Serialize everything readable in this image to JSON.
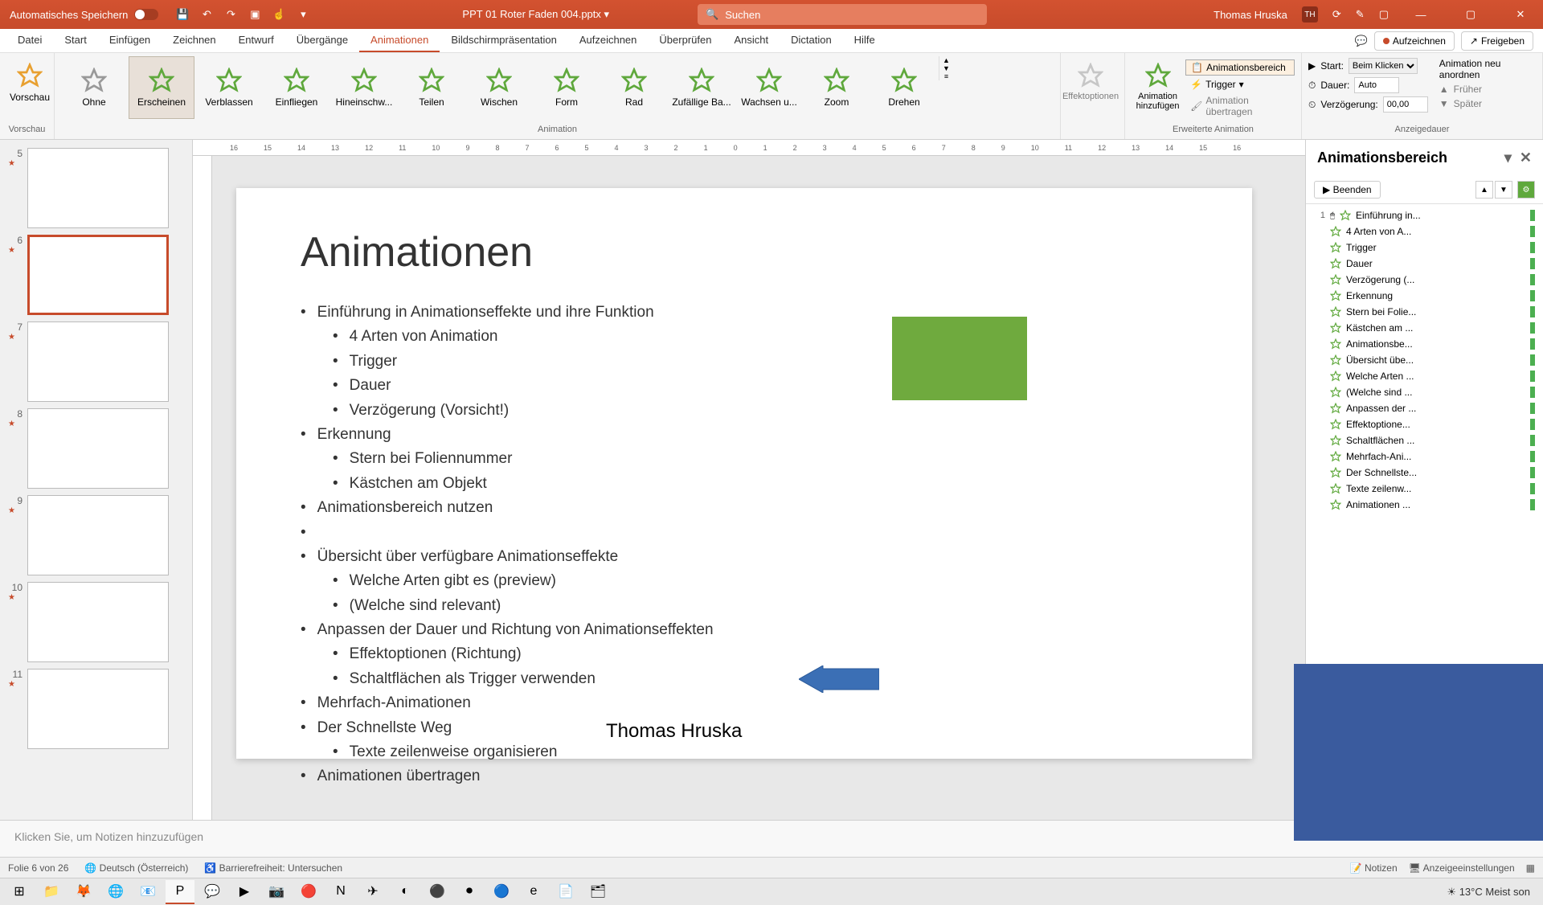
{
  "titlebar": {
    "autosave": "Automatisches Speichern",
    "filename": "PPT 01 Roter Faden 004.pptx",
    "search_placeholder": "Suchen",
    "username": "Thomas Hruska",
    "user_initials": "TH"
  },
  "tabs": {
    "items": [
      "Datei",
      "Start",
      "Einfügen",
      "Zeichnen",
      "Entwurf",
      "Übergänge",
      "Animationen",
      "Bildschirmpräsentation",
      "Aufzeichnen",
      "Überprüfen",
      "Ansicht",
      "Dictation",
      "Hilfe"
    ],
    "active_index": 6,
    "aufzeichnen": "Aufzeichnen",
    "freigeben": "Freigeben"
  },
  "ribbon": {
    "vorschau": "Vorschau",
    "vorschau_label": "Vorschau",
    "anims": [
      "Ohne",
      "Erscheinen",
      "Verblassen",
      "Einfliegen",
      "Hineinschw...",
      "Teilen",
      "Wischen",
      "Form",
      "Rad",
      "Zufällige Ba...",
      "Wachsen u...",
      "Zoom",
      "Drehen"
    ],
    "anim_group": "Animation",
    "effektoptionen": "Effektoptionen",
    "anim_hinzu": "Animation hinzufügen",
    "animbereich": "Animationsbereich",
    "trigger": "Trigger",
    "anim_uebertragen": "Animation übertragen",
    "erweiterte": "Erweiterte Animation",
    "start_label": "Start:",
    "start_val": "Beim Klicken",
    "dauer_label": "Dauer:",
    "dauer_val": "Auto",
    "verz_label": "Verzögerung:",
    "verz_val": "00,00",
    "neuanordnen": "Animation neu anordnen",
    "frueher": "Früher",
    "spaeter": "Später",
    "anzeigedauer": "Anzeigedauer"
  },
  "ruler": [
    "16",
    "15",
    "14",
    "13",
    "12",
    "11",
    "10",
    "9",
    "8",
    "7",
    "6",
    "5",
    "4",
    "3",
    "2",
    "1",
    "0",
    "1",
    "2",
    "3",
    "4",
    "5",
    "6",
    "7",
    "8",
    "9",
    "10",
    "11",
    "12",
    "13",
    "14",
    "15",
    "16"
  ],
  "thumbs": [
    {
      "num": "5"
    },
    {
      "num": "6",
      "active": true
    },
    {
      "num": "7"
    },
    {
      "num": "8"
    },
    {
      "num": "9"
    },
    {
      "num": "10"
    },
    {
      "num": "11"
    }
  ],
  "slide": {
    "title": "Animationen",
    "bullets": [
      {
        "t": "Einführung in Animationseffekte und ihre Funktion",
        "sub": [
          "4 Arten von Animation",
          "Trigger",
          "Dauer",
          "Verzögerung (Vorsicht!)"
        ]
      },
      {
        "t": "Erkennung",
        "sub": [
          "Stern bei Foliennummer",
          "Kästchen am Objekt"
        ]
      },
      {
        "t": "Animationsbereich nutzen",
        "sub": []
      },
      {
        "t": "",
        "sub": []
      },
      {
        "t": "Übersicht über verfügbare Animationseffekte",
        "sub": [
          "Welche Arten gibt es (preview)",
          "(Welche sind relevant)"
        ]
      },
      {
        "t": "Anpassen der Dauer und Richtung von Animationseffekten",
        "sub": [
          "Effektoptionen (Richtung)",
          "Schaltflächen als Trigger verwenden"
        ]
      },
      {
        "t": "Mehrfach-Animationen",
        "sub": []
      },
      {
        "t": "Der Schnellste Weg",
        "sub": [
          "Texte zeilenweise organisieren"
        ]
      },
      {
        "t": "Animationen übertragen",
        "sub": []
      }
    ],
    "author": "Thomas Hruska"
  },
  "pane": {
    "title": "Animationsbereich",
    "play": "Beenden",
    "items": [
      {
        "n": "1",
        "t": "Einführung in..."
      },
      {
        "n": "",
        "t": "4 Arten von A..."
      },
      {
        "n": "",
        "t": "Trigger"
      },
      {
        "n": "",
        "t": "Dauer"
      },
      {
        "n": "",
        "t": "Verzögerung (..."
      },
      {
        "n": "",
        "t": "Erkennung"
      },
      {
        "n": "",
        "t": "Stern bei Folie..."
      },
      {
        "n": "",
        "t": "Kästchen am ..."
      },
      {
        "n": "",
        "t": "Animationsbe..."
      },
      {
        "n": "",
        "t": "Übersicht übe..."
      },
      {
        "n": "",
        "t": "Welche Arten ..."
      },
      {
        "n": "",
        "t": "(Welche sind ..."
      },
      {
        "n": "",
        "t": "Anpassen der ..."
      },
      {
        "n": "",
        "t": "Effektoptione..."
      },
      {
        "n": "",
        "t": "Schaltflächen ..."
      },
      {
        "n": "",
        "t": "Mehrfach-Ani..."
      },
      {
        "n": "",
        "t": "Der Schnellste..."
      },
      {
        "n": "",
        "t": "Texte zeilenw..."
      },
      {
        "n": "",
        "t": "Animationen ..."
      }
    ]
  },
  "notes": "Klicken Sie, um Notizen hinzuzufügen",
  "status": {
    "slide": "Folie 6 von 26",
    "lang": "Deutsch (Österreich)",
    "access": "Barrierefreiheit: Untersuchen",
    "notizen": "Notizen",
    "anzeige": "Anzeigeeinstellungen"
  },
  "taskbar": {
    "weather": "13°C  Meist son"
  }
}
